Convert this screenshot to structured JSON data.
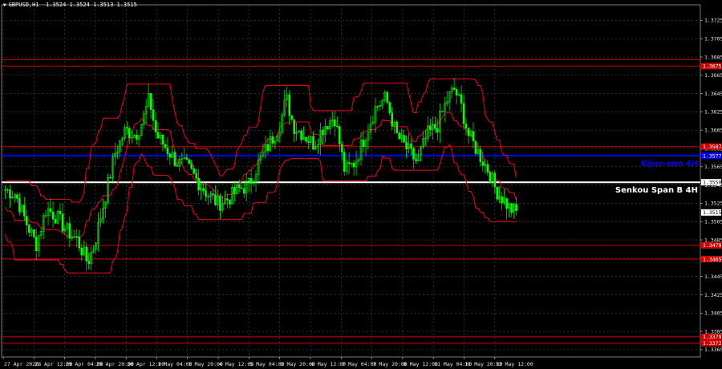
{
  "header": {
    "symbol": "GBPUSD,H1",
    "ohlc": "1.3524 1.3524 1.3513 1.3515"
  },
  "chart_data": {
    "type": "candlestick",
    "y_ticks": [
      "1.3725",
      "1.3705",
      "1.3685",
      "1.3665",
      "1.3645",
      "1.3625",
      "1.3605",
      "1.3585",
      "1.3565",
      "1.3545",
      "1.3525",
      "1.3505",
      "1.3485",
      "1.3465",
      "1.3445",
      "1.3425",
      "1.3405",
      "1.3385",
      "1.3365"
    ],
    "ylim": [
      1.3357,
      1.3742
    ],
    "x_ticks": [
      "27 Apr 2026",
      "28 Apr 12:00",
      "29 Apr 04:00",
      "29 Apr 20:00",
      "30 Apr 12:00",
      "1 May 04:00",
      "1 May 20:00",
      "4 May 12:00",
      "5 May 04:00",
      "5 May 20:00",
      "6 May 12:00",
      "7 May 04:00",
      "7 May 20:00",
      "8 May 12:00",
      "11 May 04:00",
      "11 May 20:00",
      "12 May 12:00"
    ],
    "n_bars": 215,
    "horizontal_levels": [
      {
        "value": 1.3675,
        "label": "1.3675",
        "color": "#d20000"
      },
      {
        "value": 1.3682,
        "label": "",
        "color": "#d20000"
      },
      {
        "value": 1.3587,
        "label": "1.3587",
        "color": "#d20000"
      },
      {
        "value": 1.3577,
        "label": "1.3577",
        "color": "#0000ff"
      },
      {
        "value": 1.3548,
        "label": "1.3550",
        "color": "#ffffff"
      },
      {
        "value": 1.3479,
        "label": "1.3479",
        "color": "#d20000"
      },
      {
        "value": 1.3464,
        "label": "1.3465",
        "color": "#d20000"
      },
      {
        "value": 1.3379,
        "label": "1.3379",
        "color": "#d20000"
      },
      {
        "value": 1.3372,
        "label": "1.3372",
        "color": "#d20000"
      }
    ],
    "current_price": "1.3515",
    "annotations": {
      "kijun": "Kijun-sen 4H",
      "senkou": "Senkou Span B 4H"
    },
    "close_anchors": [
      [
        0,
        1.354
      ],
      [
        6,
        1.3535
      ],
      [
        12,
        1.3505
      ],
      [
        18,
        1.348
      ],
      [
        24,
        1.352
      ],
      [
        30,
        1.351
      ],
      [
        36,
        1.3495
      ],
      [
        42,
        1.3485
      ],
      [
        48,
        1.346
      ],
      [
        52,
        1.348
      ],
      [
        58,
        1.353
      ],
      [
        64,
        1.358
      ],
      [
        70,
        1.3605
      ],
      [
        76,
        1.36
      ],
      [
        80,
        1.3615
      ],
      [
        84,
        1.364
      ],
      [
        88,
        1.36
      ],
      [
        94,
        1.3585
      ],
      [
        100,
        1.357
      ],
      [
        106,
        1.3565
      ],
      [
        112,
        1.355
      ],
      [
        118,
        1.3535
      ],
      [
        124,
        1.3525
      ],
      [
        130,
        1.353
      ],
      [
        136,
        1.354
      ],
      [
        142,
        1.3545
      ],
      [
        148,
        1.357
      ],
      [
        154,
        1.359
      ],
      [
        160,
        1.361
      ],
      [
        164,
        1.364
      ],
      [
        168,
        1.361
      ],
      [
        174,
        1.36
      ],
      [
        180,
        1.359
      ],
      [
        186,
        1.361
      ],
      [
        192,
        1.362
      ],
      [
        198,
        1.356
      ],
      [
        204,
        1.357
      ],
      [
        210,
        1.36
      ],
      [
        216,
        1.363
      ],
      [
        222,
        1.364
      ],
      [
        228,
        1.36
      ],
      [
        234,
        1.3585
      ],
      [
        240,
        1.357
      ],
      [
        246,
        1.36
      ],
      [
        252,
        1.361
      ],
      [
        258,
        1.364
      ],
      [
        262,
        1.365
      ],
      [
        266,
        1.363
      ],
      [
        270,
        1.36
      ],
      [
        276,
        1.358
      ],
      [
        282,
        1.356
      ],
      [
        286,
        1.354
      ],
      [
        290,
        1.353
      ],
      [
        294,
        1.352
      ],
      [
        298,
        1.3515
      ]
    ],
    "colors": {
      "background": "#000000",
      "grid": "#4a5a6a",
      "candle": "#00ff00",
      "bands": "#e0001b",
      "blue_level": "#0000ff",
      "white_level": "#ffffff",
      "axis_text": "#e6e6e6"
    }
  }
}
